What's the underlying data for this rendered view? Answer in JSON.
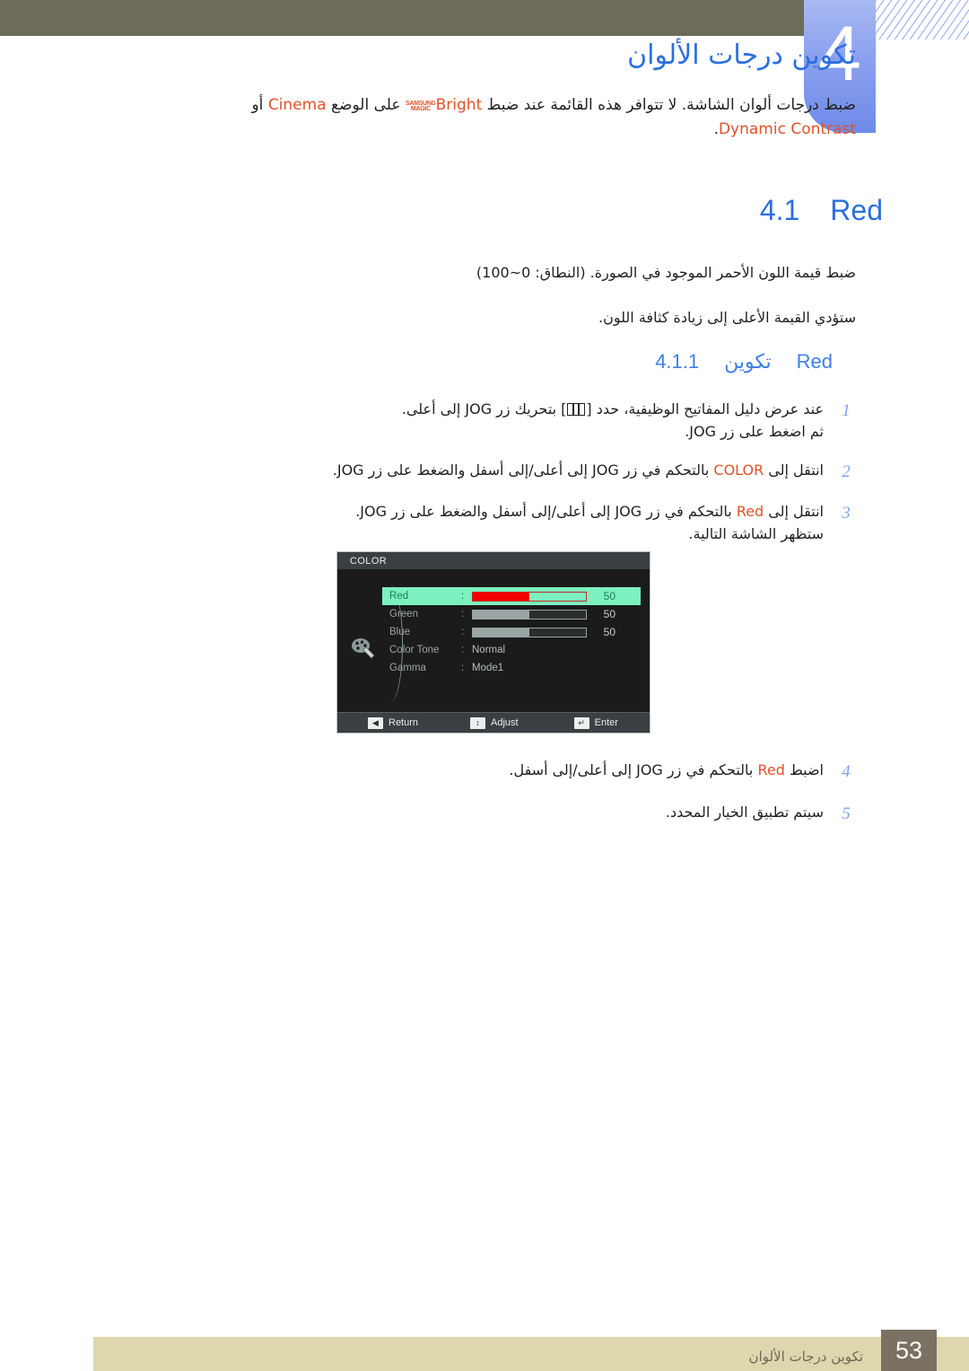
{
  "chapter": {
    "number": "4",
    "title": "تكوين درجات الألوان",
    "intro_parts": {
      "before": "ضبط درجات ألوان الشاشة. لا تتوافر هذه القائمة عند ضبط",
      "magic_brand_line1": "SAMSUNG",
      "magic_brand_line2": "MAGIC",
      "magic_word": "Bright",
      "middle": "على الوضع",
      "cinema": "Cinema",
      "or": "أو",
      "dynamic_contrast": "Dynamic Contrast",
      "end": "."
    }
  },
  "section": {
    "number": "4.1",
    "label": "Red",
    "paragraphs": [
      "ضبط قيمة اللون الأحمر الموجود في الصورة. (النطاق: 0~100)",
      "ستؤدي القيمة الأعلى إلى زيادة كثافة اللون."
    ]
  },
  "subsection": {
    "number": "4.1.1",
    "label_ar": "تكوين",
    "label_en": "Red"
  },
  "steps": [
    {
      "marker": "1",
      "line1_a": "عند عرض دليل المفاتيح الوظيفية، حدد [",
      "line1_icon": "keyguide-menu-icon",
      "line1_b": "] بتحريك زر JOG إلى أعلى.",
      "line2": "ثم اضغط على زر JOG."
    },
    {
      "marker": "2",
      "text_a": "انتقل إلى",
      "highlight": "COLOR",
      "text_b": "بالتحكم في زر JOG إلى أعلى/إلى أسفل والضغط على زر JOG."
    },
    {
      "marker": "3",
      "text_a": "انتقل إلى",
      "highlight": "Red",
      "text_b": "بالتحكم في زر JOG إلى أعلى/إلى أسفل والضغط على زر JOG.",
      "line2": "ستظهر الشاشة التالية."
    }
  ],
  "steps_bottom": [
    {
      "marker": "4",
      "text_a": "اضبط",
      "highlight": "Red",
      "text_b": "بالتحكم في زر JOG إلى أعلى/إلى أسفل."
    },
    {
      "marker": "5",
      "text_a": "سيتم تطبيق الخيار المحدد.",
      "highlight": "",
      "text_b": ""
    }
  ],
  "osd": {
    "title": "COLOR",
    "rows": [
      {
        "label": "Red",
        "type": "slider",
        "value": "50",
        "fill_pct": 50,
        "selected": true
      },
      {
        "label": "Green",
        "type": "slider",
        "value": "50",
        "fill_pct": 50,
        "selected": false
      },
      {
        "label": "Blue",
        "type": "slider",
        "value": "50",
        "fill_pct": 50,
        "selected": false
      },
      {
        "label": "Color Tone",
        "type": "option",
        "value": "Normal",
        "selected": false
      },
      {
        "label": "Gamma",
        "type": "option",
        "value": "Mode1",
        "selected": false
      }
    ],
    "footer": [
      {
        "glyph": "◀",
        "label": "Return"
      },
      {
        "glyph": "↕",
        "label": "Adjust"
      },
      {
        "glyph": "↵",
        "label": "Enter"
      }
    ],
    "icon": "palette-icon"
  },
  "footer": {
    "label": "تكوين درجات الألوان",
    "page": "53"
  },
  "colors": {
    "accent_blue": "#2b6fe0",
    "highlight_orange": "#e0522a",
    "olive_bar": "#6d6c58",
    "footer_beige": "#ded6ad",
    "page_badge": "#7a7162",
    "osd_selected": "#7df0c0",
    "osd_red_fill": "#f20000"
  }
}
